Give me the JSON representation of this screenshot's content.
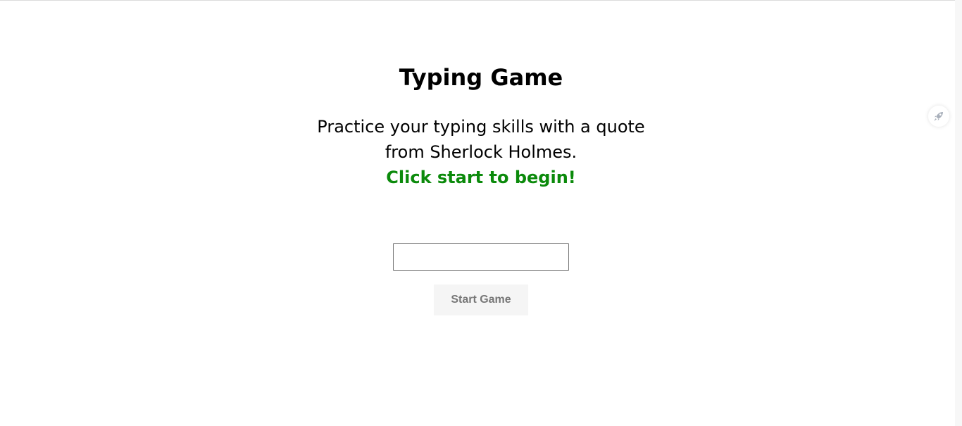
{
  "header": {
    "title": "Typing Game"
  },
  "intro": {
    "line1": "Practice your typing skills with a quote",
    "line2": "from Sherlock Holmes.",
    "cta": "Click start to begin!"
  },
  "input": {
    "value": "",
    "placeholder": ""
  },
  "controls": {
    "start_label": "Start Game"
  },
  "side_widget": {
    "icon": "rocket-icon"
  },
  "colors": {
    "cta": "#0b8a0b",
    "button_bg": "#f5f5f5",
    "button_text": "#777777"
  }
}
